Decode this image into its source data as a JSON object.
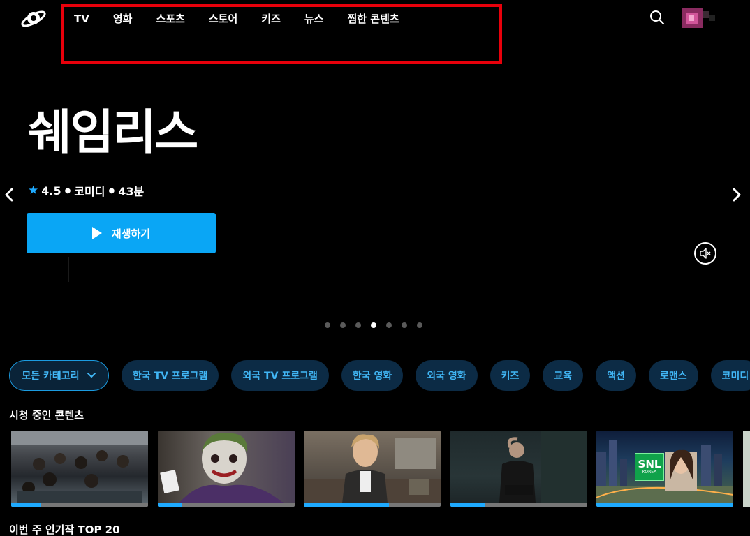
{
  "nav": {
    "items": [
      "TV",
      "영화",
      "스포츠",
      "스토어",
      "키즈",
      "뉴스",
      "찜한 콘텐츠"
    ]
  },
  "hero": {
    "title": "쉐임리스",
    "rating": "4.5",
    "genre": "코미디",
    "duration": "43분",
    "play_label": "재생하기",
    "slide_count": 7,
    "active_slide": 4
  },
  "categories": {
    "selected": "모든 카테고리",
    "items": [
      "한국 TV 프로그램",
      "외국 TV 프로그램",
      "한국 영화",
      "외국 영화",
      "키즈",
      "교육",
      "액션",
      "로맨스",
      "코미디"
    ]
  },
  "sections": {
    "watching_title": "시청 중인 콘텐츠",
    "popular_title": "이번 주 인기작 TOP 20"
  },
  "watching": [
    {
      "progress": 0.22
    },
    {
      "progress": 0.18
    },
    {
      "progress": 0.62
    },
    {
      "progress": 0.25
    },
    {
      "progress": 1.0,
      "badge": "SNL",
      "badge_sub": "KOREA"
    }
  ],
  "colors": {
    "accent": "#0aa6f5",
    "highlight_box": "#e8000b",
    "chip_bg": "#0c2b45",
    "chip_text": "#41b6f5"
  },
  "icons": {
    "logo": "planet-logo-icon",
    "search": "search-icon",
    "prev": "chevron-left-icon",
    "next": "chevron-right-icon",
    "mute": "speaker-muted-icon",
    "star": "star-icon",
    "play": "play-icon"
  }
}
